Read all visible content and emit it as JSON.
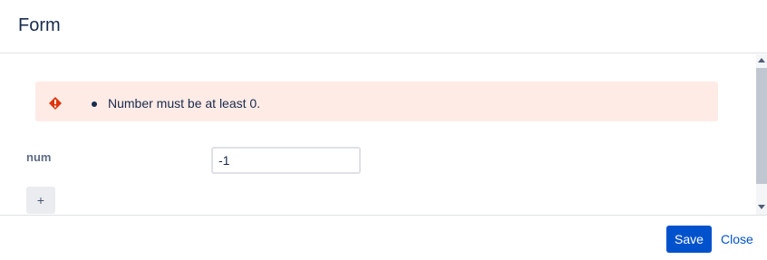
{
  "dialog": {
    "title": "Form"
  },
  "errors": {
    "items": [
      "Number must be at least 0."
    ],
    "icon": "error-icon",
    "color": "#de350b",
    "background": "#ffebe6"
  },
  "form": {
    "field_label": "num",
    "field_value": "-1",
    "add_label": "+"
  },
  "footer": {
    "save_label": "Save",
    "close_label": "Close"
  },
  "colors": {
    "primary": "#0052cc",
    "text": "#172b4d",
    "label": "#5e6c84"
  }
}
